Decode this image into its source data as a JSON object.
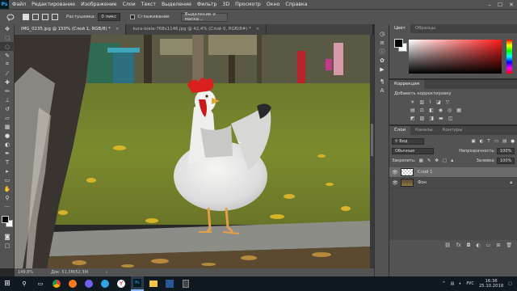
{
  "menubar": {
    "logo": "Ps",
    "items": [
      "Файл",
      "Редактирование",
      "Изображение",
      "Слои",
      "Текст",
      "Выделение",
      "Фильтр",
      "3D",
      "Просмотр",
      "Окно",
      "Справка"
    ],
    "window_controls": [
      "–",
      "☐",
      "✕"
    ]
  },
  "options_bar": {
    "feather_label": "Растушевка:",
    "feather_value": "0 пикс",
    "antialias_label": "Сглаживание",
    "select_mask_button": "Выделение и маска..."
  },
  "doc_tabs": [
    {
      "label": "IMG_0235.jpg @ 150% (Слой 1, RGB/8) *",
      "close": "×"
    },
    {
      "label": "kura-biala-768x1146.jpg @ 42,4% (Слой 0, RGB/8#) *",
      "close": "×"
    }
  ],
  "statusbar": {
    "zoom": "149,8%",
    "doc": "Док: 51,3M/52,3M",
    "arrow": "›"
  },
  "color_panel": {
    "tabs": [
      "Цвет",
      "Образцы"
    ],
    "fg_color": "#000000",
    "bg_color": "#ffffff",
    "hue_color": "#ff1a1a"
  },
  "adjustments_panel": {
    "tab": "Коррекция",
    "title": "Добавить корректировку"
  },
  "layers_panel": {
    "tabs": [
      "Слои",
      "Каналы",
      "Контуры"
    ],
    "kind_filter": "Вид",
    "blend_mode": "Обычные",
    "opacity_label": "Непрозрачность:",
    "opacity_value": "100%",
    "lock_label": "Закрепить:",
    "fill_label": "Заливка:",
    "fill_value": "100%",
    "layers": [
      {
        "name": "Слой 1",
        "selected": true
      },
      {
        "name": "Фон",
        "selected": false
      }
    ]
  },
  "taskbar": {
    "start": "⊞",
    "apps": [
      "search",
      "task-view",
      "chrome",
      "firefox",
      "viber",
      "telegram",
      "yandex",
      "photoshop",
      "explorer",
      "word",
      "calc"
    ],
    "lang": "РУС",
    "time": "16:36",
    "date": "25.10.2018"
  }
}
